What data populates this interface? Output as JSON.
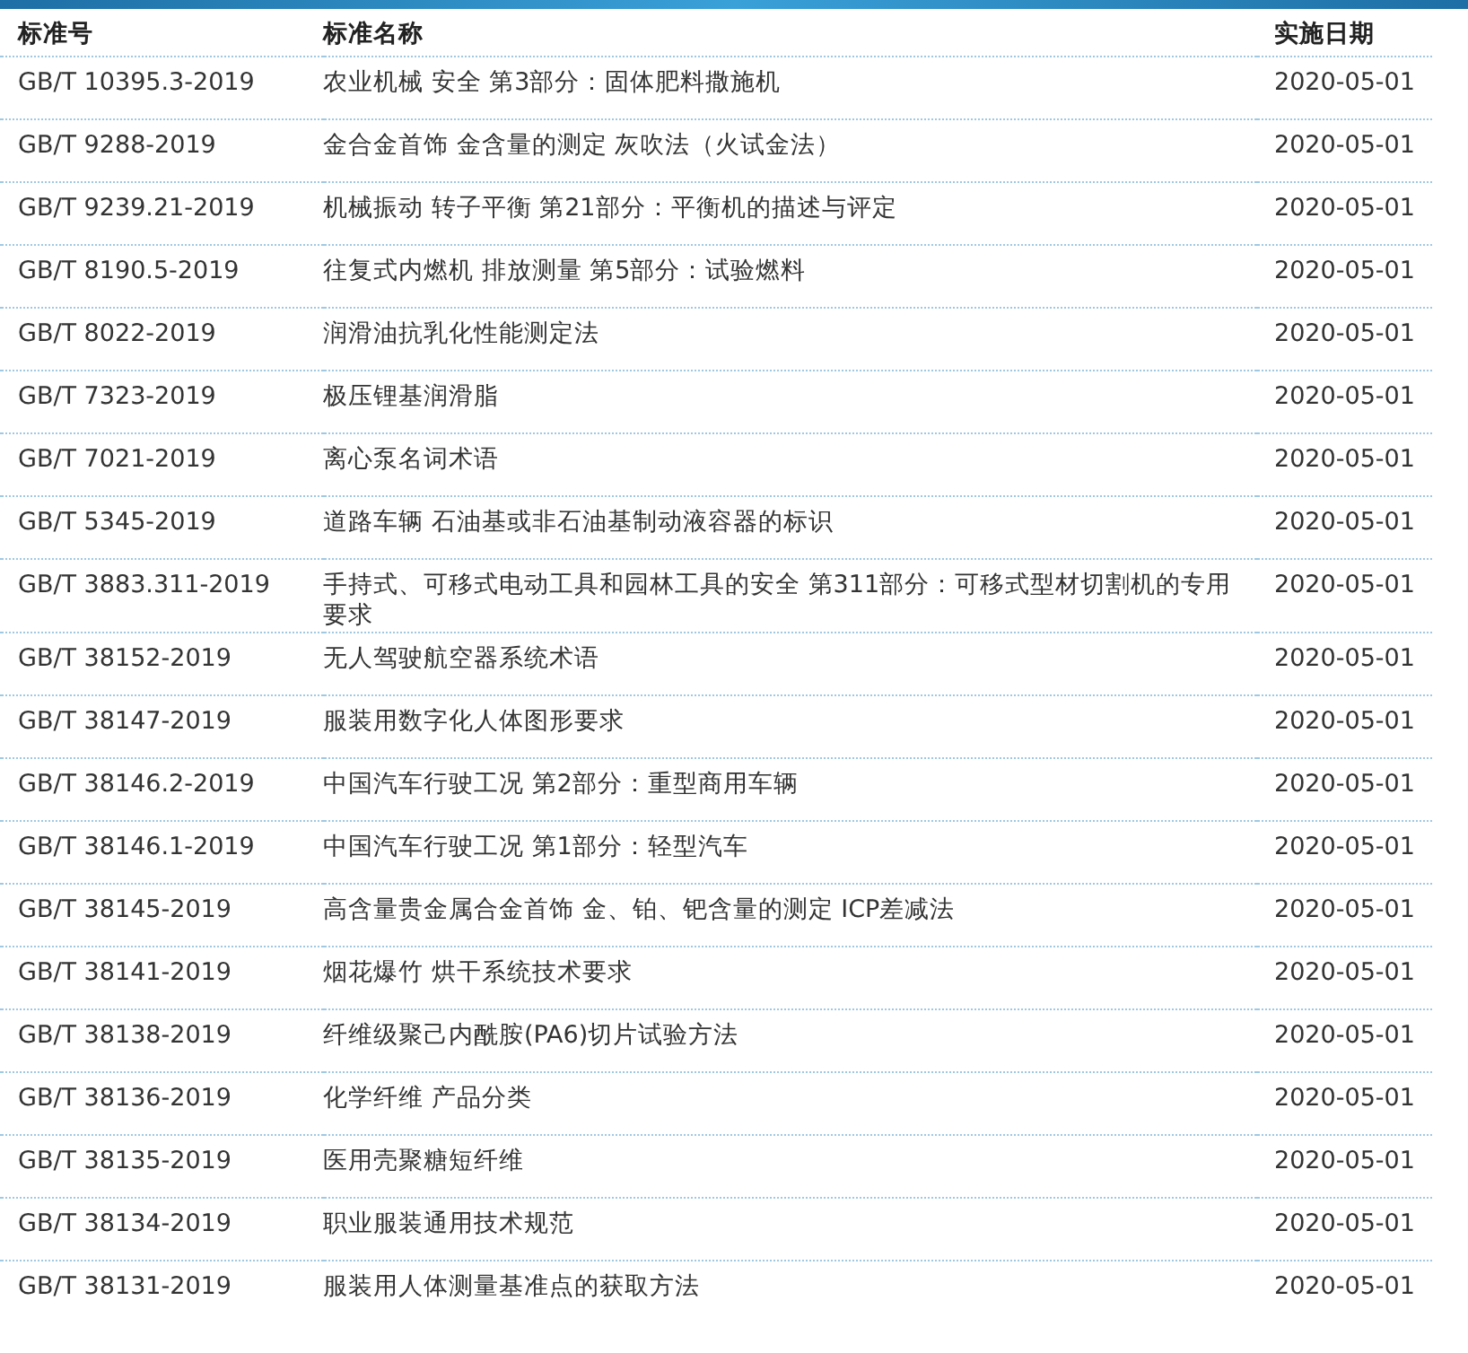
{
  "columns": [
    "标准号",
    "标准名称",
    "实施日期"
  ],
  "rows": [
    [
      "GB/T 10395.3-2019",
      "农业机械 安全 第3部分：固体肥料撒施机",
      "2020-05-01"
    ],
    [
      "GB/T 9288-2019",
      "金合金首饰 金含量的测定 灰吹法（火试金法）",
      "2020-05-01"
    ],
    [
      "GB/T 9239.21-2019",
      "机械振动 转子平衡 第21部分：平衡机的描述与评定",
      "2020-05-01"
    ],
    [
      "GB/T 8190.5-2019",
      "往复式内燃机 排放测量 第5部分：试验燃料",
      "2020-05-01"
    ],
    [
      "GB/T 8022-2019",
      "润滑油抗乳化性能测定法",
      "2020-05-01"
    ],
    [
      "GB/T 7323-2019",
      "极压锂基润滑脂",
      "2020-05-01"
    ],
    [
      "GB/T 7021-2019",
      "离心泵名词术语",
      "2020-05-01"
    ],
    [
      "GB/T 5345-2019",
      "道路车辆 石油基或非石油基制动液容器的标识",
      "2020-05-01"
    ],
    [
      "GB/T 3883.311-2019",
      "手持式、可移式电动工具和园林工具的安全 第311部分：可移式型材切割机的专用要求",
      "2020-05-01"
    ],
    [
      "GB/T 38152-2019",
      "无人驾驶航空器系统术语",
      "2020-05-01"
    ],
    [
      "GB/T 38147-2019",
      "服装用数字化人体图形要求",
      "2020-05-01"
    ],
    [
      "GB/T 38146.2-2019",
      "中国汽车行驶工况 第2部分：重型商用车辆",
      "2020-05-01"
    ],
    [
      "GB/T 38146.1-2019",
      "中国汽车行驶工况 第1部分：轻型汽车",
      "2020-05-01"
    ],
    [
      "GB/T 38145-2019",
      "高含量贵金属合金首饰 金、铂、钯含量的测定 ICP差减法",
      "2020-05-01"
    ],
    [
      "GB/T 38141-2019",
      "烟花爆竹 烘干系统技术要求",
      "2020-05-01"
    ],
    [
      "GB/T 38138-2019",
      "纤维级聚己内酰胺(PA6)切片试验方法",
      "2020-05-01"
    ],
    [
      "GB/T 38136-2019",
      "化学纤维 产品分类",
      "2020-05-01"
    ],
    [
      "GB/T 38135-2019",
      "医用壳聚糖短纤维",
      "2020-05-01"
    ],
    [
      "GB/T 38134-2019",
      "职业服装通用技术规范",
      "2020-05-01"
    ],
    [
      "GB/T 38131-2019",
      "服装用人体测量基准点的获取方法",
      "2020-05-01"
    ]
  ]
}
